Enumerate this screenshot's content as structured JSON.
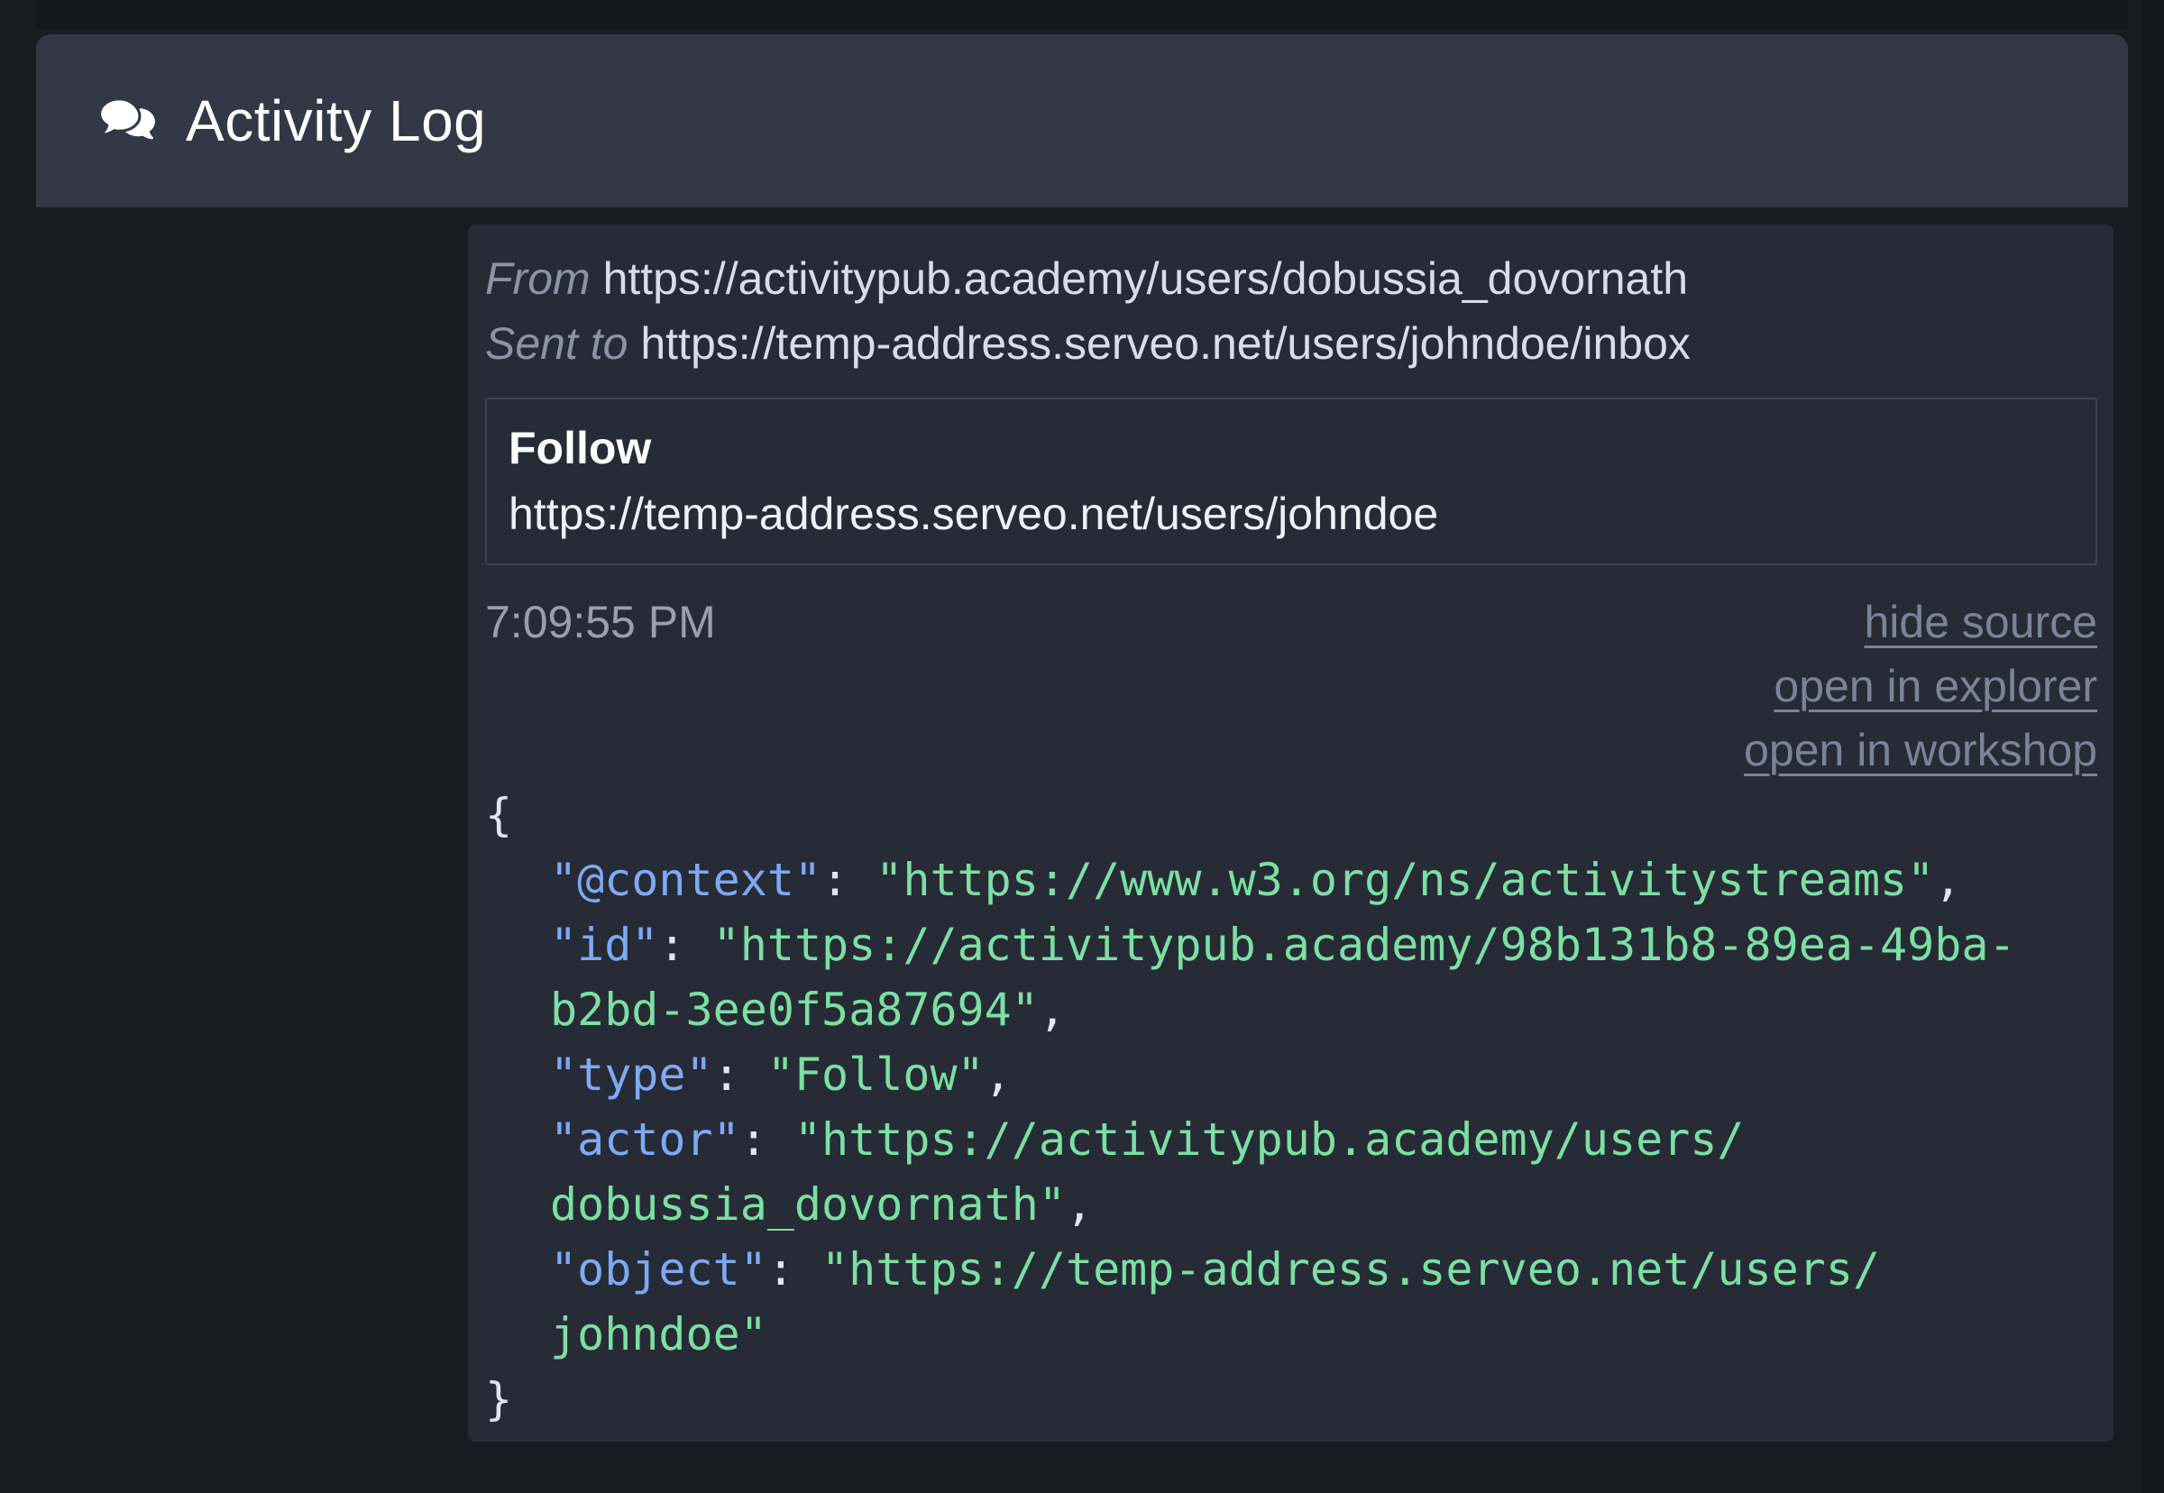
{
  "header": {
    "title": "Activity Log",
    "icon": "comments-icon"
  },
  "entry": {
    "from_label": "From",
    "from_url": "https://activitypub.academy/users/dobussia_dovornath",
    "sent_to_label": "Sent to",
    "sent_to_url": "https://temp-address.serveo.net/users/johndoe/inbox",
    "activity": {
      "type_label": "Follow",
      "object_url": "https://temp-address.serveo.net/users/johndoe"
    },
    "timestamp": "7:09:55 PM",
    "links": [
      {
        "label": "hide source"
      },
      {
        "label": "open in explorer"
      },
      {
        "label": "open in workshop"
      }
    ],
    "source": {
      "lines": [
        {
          "indent": 0,
          "segments": [
            {
              "text": "{",
              "style": "punct"
            }
          ]
        },
        {
          "indent": 1,
          "segments": [
            {
              "text": "\"@context\"",
              "style": "key"
            },
            {
              "text": ": ",
              "style": "punct"
            },
            {
              "text": "\"https://www.w3.org/ns/activitystreams\"",
              "style": "string"
            },
            {
              "text": ",",
              "style": "punct"
            }
          ]
        },
        {
          "indent": 1,
          "segments": [
            {
              "text": "\"id\"",
              "style": "key"
            },
            {
              "text": ": ",
              "style": "punct"
            },
            {
              "text": "\"https://activitypub.academy/98b131b8-89ea-49ba-",
              "style": "string"
            }
          ]
        },
        {
          "indent": 1,
          "segments": [
            {
              "text": "b2bd-3ee0f5a87694\"",
              "style": "string"
            },
            {
              "text": ",",
              "style": "punct"
            }
          ]
        },
        {
          "indent": 1,
          "segments": [
            {
              "text": "\"type\"",
              "style": "key"
            },
            {
              "text": ": ",
              "style": "punct"
            },
            {
              "text": "\"Follow\"",
              "style": "string"
            },
            {
              "text": ",",
              "style": "punct"
            }
          ]
        },
        {
          "indent": 1,
          "segments": [
            {
              "text": "\"actor\"",
              "style": "key"
            },
            {
              "text": ": ",
              "style": "punct"
            },
            {
              "text": "\"https://activitypub.academy/users/",
              "style": "string"
            }
          ]
        },
        {
          "indent": 1,
          "segments": [
            {
              "text": "dobussia_dovornath\"",
              "style": "string"
            },
            {
              "text": ",",
              "style": "punct"
            }
          ]
        },
        {
          "indent": 1,
          "segments": [
            {
              "text": "\"object\"",
              "style": "key"
            },
            {
              "text": ": ",
              "style": "punct"
            },
            {
              "text": "\"https://temp-address.serveo.net/users/",
              "style": "string"
            }
          ]
        },
        {
          "indent": 1,
          "segments": [
            {
              "text": "johndoe\"",
              "style": "string"
            }
          ]
        },
        {
          "indent": 0,
          "segments": [
            {
              "text": "}",
              "style": "punct"
            }
          ]
        }
      ]
    }
  },
  "colors": {
    "page_background": "#191b22",
    "header_background": "#333847",
    "card_background": "#272b36",
    "box_border": "#3f4555",
    "muted_text": "#8b94a5",
    "timestamp_text": "#98a0ae",
    "link_text": "#7a8499",
    "json_key": "#7ea9f4",
    "json_string": "#7cdfa3",
    "json_punctuation": "#e0e5ee"
  }
}
